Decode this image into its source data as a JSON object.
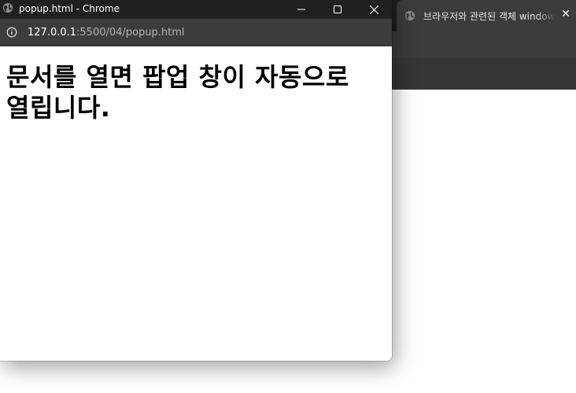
{
  "background_window": {
    "tab_title": "브라우저와 관련된 객체 window",
    "tab_close": "✕"
  },
  "popup": {
    "title": "popup.html - Chrome",
    "url_host": "127.0.0.1",
    "url_path": ":5500/04/popup.html",
    "heading": "문서를 열면 팝업 창이 자동으로 열립니다."
  },
  "colors": {
    "titlebar": "#202020",
    "addressbar": "#3c3c3c",
    "tabstrip": "#1f1f1f",
    "page_background": "#ffffff"
  },
  "icons": {
    "tab_favicon": "globe-icon",
    "popup_favicon": "globe-icon",
    "site_info": "info-icon",
    "minimize": "minimize-icon",
    "maximize": "maximize-icon",
    "close": "close-icon"
  }
}
